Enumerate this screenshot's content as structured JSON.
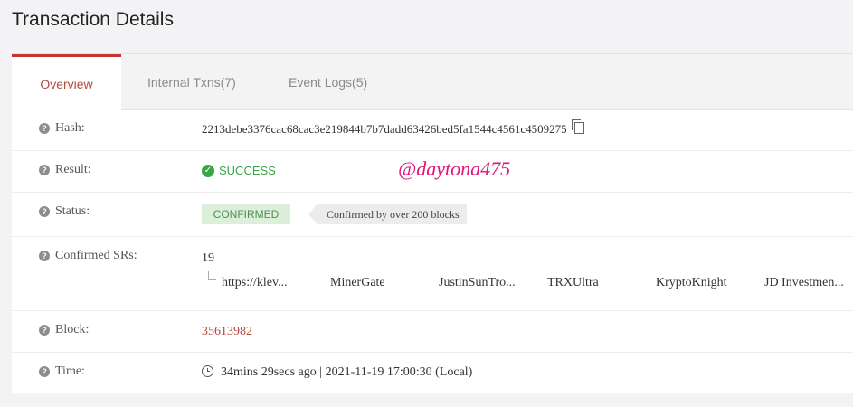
{
  "page": {
    "title": "Transaction Details"
  },
  "tabs": [
    {
      "label": "Overview"
    },
    {
      "label": "Internal Txns(7)"
    },
    {
      "label": "Event Logs(5)"
    }
  ],
  "rows": {
    "hash": {
      "label": "Hash:",
      "value": "2213debe3376cac68cac3e219844b7b7dadd63426bed5fa1544c4561c4509275"
    },
    "result": {
      "label": "Result:",
      "value": "SUCCESS"
    },
    "status": {
      "label": "Status:",
      "badge": "CONFIRMED",
      "tooltip": "Confirmed by over 200 blocks"
    },
    "confirmed_srs": {
      "label": "Confirmed SRs:",
      "count": "19",
      "items": [
        "https://klev...",
        "MinerGate",
        "JustinSunTro...",
        "TRXUltra",
        "KryptoKnight",
        "JD Investmen..."
      ]
    },
    "block": {
      "label": "Block:",
      "value": "35613982"
    },
    "time": {
      "label": "Time:",
      "value": "34mins 29secs ago | 2021-11-19 17:00:30 (Local)"
    }
  },
  "watermark": "@daytona475",
  "colors": {
    "accent": "#c23631",
    "success": "#3aa546",
    "link": "#b14b3c",
    "watermark": "#e0157a"
  },
  "icons": [
    "help-icon",
    "copy-icon",
    "check-circle-icon",
    "clock-icon",
    "tree-branch-icon"
  ]
}
